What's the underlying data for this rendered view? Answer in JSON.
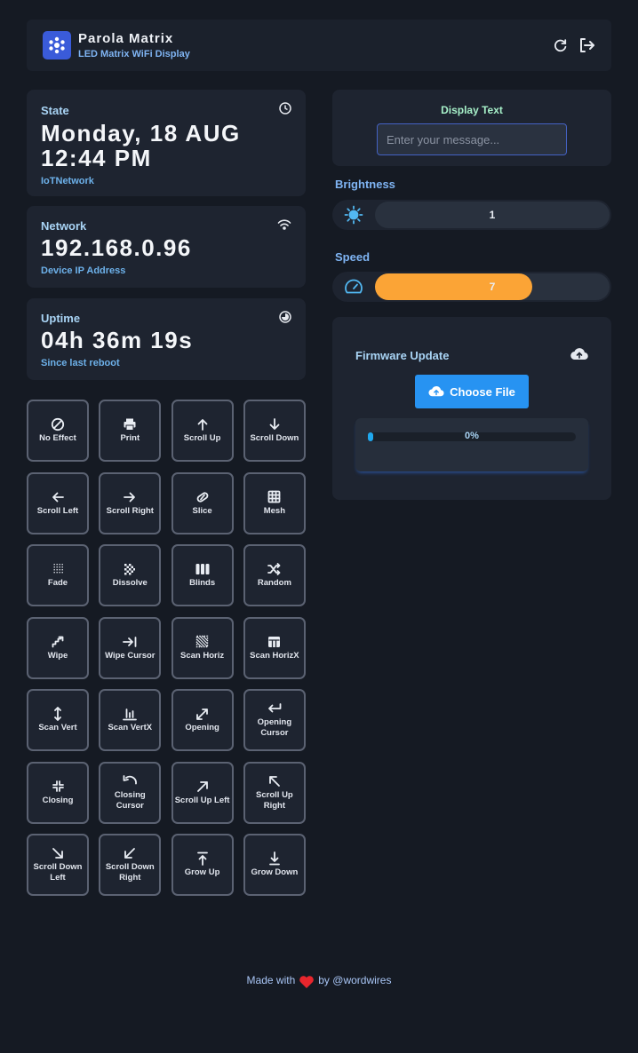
{
  "header": {
    "title": "Parola Matrix",
    "subtitle": "LED Matrix WiFi Display",
    "icons": [
      "app-logo-icon",
      "refresh-icon",
      "logout-icon"
    ]
  },
  "status_cards": {
    "state": {
      "label": "State",
      "value_line1": "Monday, 18 AUG",
      "value_line2": "12:44 PM",
      "sub": "IoTNetwork",
      "icon": "clock-icon"
    },
    "network": {
      "label": "Network",
      "value": "192.168.0.96",
      "sub": "Device IP Address",
      "icon": "wifi-icon"
    },
    "uptime": {
      "label": "Uptime",
      "value": "04h 36m 19s",
      "sub": "Since last reboot",
      "icon": "timer-icon"
    }
  },
  "effects": [
    {
      "label": "No Effect",
      "icon": "ban-icon"
    },
    {
      "label": "Print",
      "icon": "printer-icon"
    },
    {
      "label": "Scroll Up",
      "icon": "arrow-up-icon"
    },
    {
      "label": "Scroll Down",
      "icon": "arrow-down-icon"
    },
    {
      "label": "Scroll Left",
      "icon": "arrow-left-icon"
    },
    {
      "label": "Scroll Right",
      "icon": "arrow-right-icon"
    },
    {
      "label": "Slice",
      "icon": "slice-icon"
    },
    {
      "label": "Mesh",
      "icon": "grid-icon"
    },
    {
      "label": "Fade",
      "icon": "fade-icon"
    },
    {
      "label": "Dissolve",
      "icon": "dissolve-icon"
    },
    {
      "label": "Blinds",
      "icon": "blinds-icon"
    },
    {
      "label": "Random",
      "icon": "shuffle-icon"
    },
    {
      "label": "Wipe",
      "icon": "wipe-icon"
    },
    {
      "label": "Wipe Cursor",
      "icon": "arrow-to-line-icon"
    },
    {
      "label": "Scan Horiz",
      "icon": "scan-horiz-icon"
    },
    {
      "label": "Scan HorizX",
      "icon": "table-icon"
    },
    {
      "label": "Scan Vert",
      "icon": "arrows-vertical-icon"
    },
    {
      "label": "Scan VertX",
      "icon": "bar-chart-icon"
    },
    {
      "label": "Opening",
      "icon": "expand-icon"
    },
    {
      "label": "Opening Cursor",
      "icon": "return-arrow-icon"
    },
    {
      "label": "Closing",
      "icon": "compress-icon"
    },
    {
      "label": "Closing Cursor",
      "icon": "undo-icon"
    },
    {
      "label": "Scroll Up Left",
      "icon": "arrow-up-right-icon"
    },
    {
      "label": "Scroll Up Right",
      "icon": "arrow-up-left-icon"
    },
    {
      "label": "Scroll Down Left",
      "icon": "arrow-down-right-icon"
    },
    {
      "label": "Scroll Down Right",
      "icon": "arrow-down-left-icon"
    },
    {
      "label": "Grow Up",
      "icon": "arrow-up-to-line-icon"
    },
    {
      "label": "Grow Down",
      "icon": "arrow-down-to-line-icon"
    }
  ],
  "display_text": {
    "title": "Display Text",
    "placeholder": "Enter your message..."
  },
  "brightness": {
    "label": "Brightness",
    "value": "1",
    "fraction": 0.0,
    "icon": "sun-icon"
  },
  "speed": {
    "label": "Speed",
    "value": "7",
    "fraction": 0.67,
    "fill_color": "#fba436",
    "icon": "speedometer-icon"
  },
  "firmware": {
    "title": "Firmware Update",
    "button_label": "Choose File",
    "progress_text": "0%",
    "progress_fraction": 0.0,
    "icon": "cloud-upload-icon"
  },
  "footer": {
    "prefix": "Made with",
    "suffix": "by @wordwires",
    "icon": "heart-icon"
  },
  "colors": {
    "accent": "#2793f2",
    "speed_fill": "#fba436",
    "heart": "#e8262d",
    "logo_bg": "#3a5bd9"
  }
}
